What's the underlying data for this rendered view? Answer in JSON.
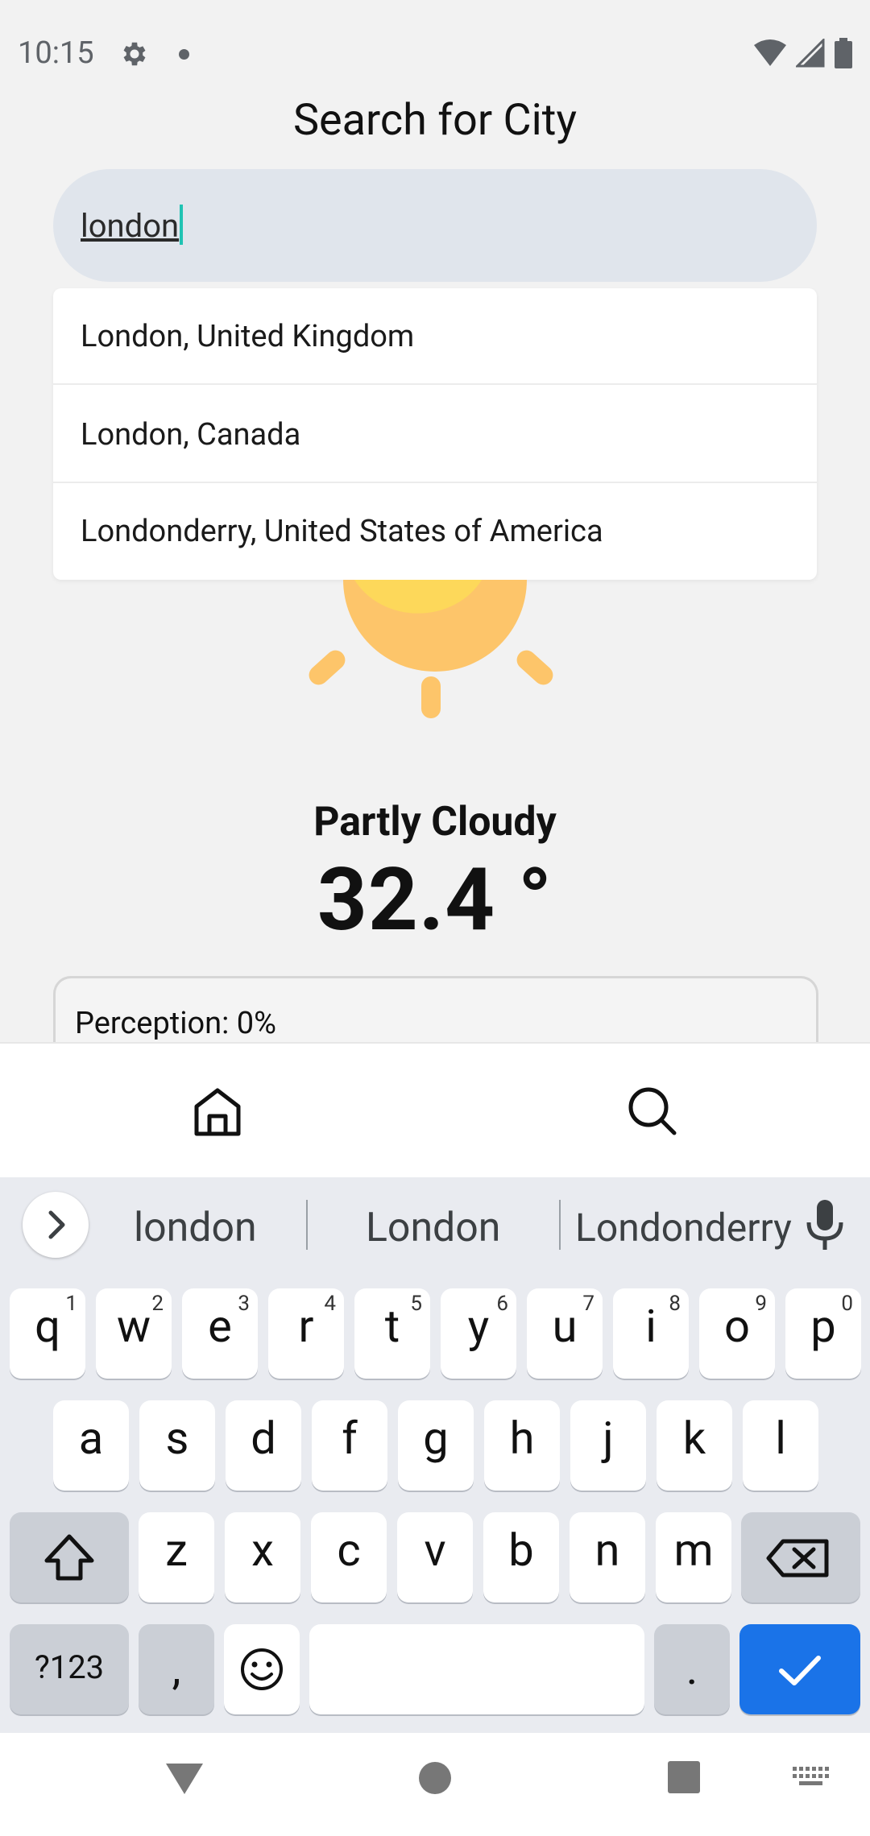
{
  "status_bar": {
    "time": "10:15"
  },
  "title": "Search for City",
  "search": {
    "value": "london"
  },
  "suggestions": [
    "London, United Kingdom",
    "London, Canada",
    "Londonderry, United States of America"
  ],
  "weather": {
    "condition": "Partly Cloudy",
    "temperature": "32.4 °",
    "precipitation_label": "Perception: 0%"
  },
  "keyboard": {
    "suggestions": [
      "london",
      "London",
      "Londonderry"
    ],
    "row1": [
      {
        "k": "q",
        "h": "1"
      },
      {
        "k": "w",
        "h": "2"
      },
      {
        "k": "e",
        "h": "3"
      },
      {
        "k": "r",
        "h": "4"
      },
      {
        "k": "t",
        "h": "5"
      },
      {
        "k": "y",
        "h": "6"
      },
      {
        "k": "u",
        "h": "7"
      },
      {
        "k": "i",
        "h": "8"
      },
      {
        "k": "o",
        "h": "9"
      },
      {
        "k": "p",
        "h": "0"
      }
    ],
    "row2": [
      "a",
      "s",
      "d",
      "f",
      "g",
      "h",
      "j",
      "k",
      "l"
    ],
    "row3": [
      "z",
      "x",
      "c",
      "v",
      "b",
      "n",
      "m"
    ],
    "symbols_label": "?123",
    "comma_label": ",",
    "period_label": "."
  }
}
